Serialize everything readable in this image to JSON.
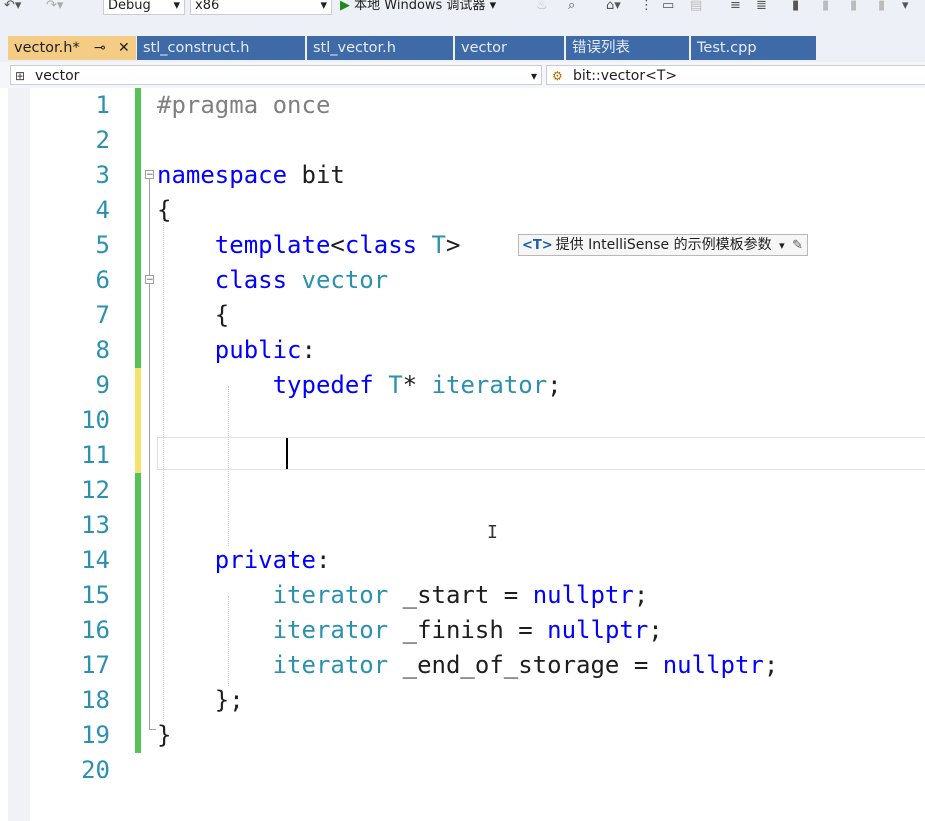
{
  "toolbar": {
    "configuration": "Debug",
    "platform": "x86",
    "run_label": "本地 Windows 调试器"
  },
  "tabs": [
    {
      "label": "vector.h*",
      "active": true,
      "pin_icon": "pin-icon",
      "close_icon": "close-icon"
    },
    {
      "label": "stl_construct.h",
      "active": false
    },
    {
      "label": "stl_vector.h",
      "active": false
    },
    {
      "label": "vector",
      "active": false
    },
    {
      "label": "错误列表",
      "active": false
    },
    {
      "label": "Test.cpp",
      "active": false
    }
  ],
  "navbar": {
    "project": "vector",
    "scope": "bit::vector<T>"
  },
  "editor": {
    "line_numbers": [
      "1",
      "2",
      "3",
      "4",
      "5",
      "6",
      "7",
      "8",
      "9",
      "10",
      "11",
      "12",
      "13",
      "14",
      "15",
      "16",
      "17",
      "18",
      "19",
      "20"
    ],
    "lines": [
      [
        {
          "t": "#pragma once",
          "c": "pp"
        }
      ],
      [],
      [
        {
          "t": "namespace",
          "c": "kw"
        },
        {
          "t": " bit",
          "c": ""
        }
      ],
      [
        {
          "t": "{",
          "c": ""
        }
      ],
      [
        {
          "t": "    ",
          "c": ""
        },
        {
          "t": "template",
          "c": "kw"
        },
        {
          "t": "<",
          "c": ""
        },
        {
          "t": "class",
          "c": "kw"
        },
        {
          "t": " ",
          "c": ""
        },
        {
          "t": "T",
          "c": "ty"
        },
        {
          "t": ">",
          "c": ""
        }
      ],
      [
        {
          "t": "    ",
          "c": ""
        },
        {
          "t": "class",
          "c": "kw"
        },
        {
          "t": " ",
          "c": ""
        },
        {
          "t": "vector",
          "c": "ty"
        }
      ],
      [
        {
          "t": "    {",
          "c": ""
        }
      ],
      [
        {
          "t": "    ",
          "c": ""
        },
        {
          "t": "public",
          "c": "kw"
        },
        {
          "t": ":",
          "c": ""
        }
      ],
      [
        {
          "t": "        ",
          "c": ""
        },
        {
          "t": "typedef",
          "c": "kw"
        },
        {
          "t": " ",
          "c": ""
        },
        {
          "t": "T",
          "c": "ty"
        },
        {
          "t": "* ",
          "c": ""
        },
        {
          "t": "iterator",
          "c": "ty"
        },
        {
          "t": ";",
          "c": ""
        }
      ],
      [],
      [],
      [],
      [],
      [
        {
          "t": "    ",
          "c": ""
        },
        {
          "t": "private",
          "c": "kw"
        },
        {
          "t": ":",
          "c": ""
        }
      ],
      [
        {
          "t": "        ",
          "c": ""
        },
        {
          "t": "iterator",
          "c": "ty"
        },
        {
          "t": " _start = ",
          "c": ""
        },
        {
          "t": "nullptr",
          "c": "kw"
        },
        {
          "t": ";",
          "c": ""
        }
      ],
      [
        {
          "t": "        ",
          "c": ""
        },
        {
          "t": "iterator",
          "c": "ty"
        },
        {
          "t": " _finish = ",
          "c": ""
        },
        {
          "t": "nullptr",
          "c": "kw"
        },
        {
          "t": ";",
          "c": ""
        }
      ],
      [
        {
          "t": "        ",
          "c": ""
        },
        {
          "t": "iterator",
          "c": "ty"
        },
        {
          "t": " _end_of_storage = ",
          "c": ""
        },
        {
          "t": "nullptr",
          "c": "kw"
        },
        {
          "t": ";",
          "c": ""
        }
      ],
      [
        {
          "t": "    };",
          "c": ""
        }
      ],
      [
        {
          "t": "}",
          "c": ""
        }
      ],
      []
    ],
    "change_markers": [
      "saved",
      "saved",
      "saved",
      "saved",
      "saved",
      "saved",
      "saved",
      "saved",
      "unsaved",
      "unsaved",
      "unsaved",
      "saved",
      "saved",
      "saved",
      "saved",
      "saved",
      "saved",
      "saved",
      "saved",
      "none"
    ],
    "colors": {
      "keyword": "#0000ff",
      "type": "#2b91af",
      "preprocessor": "#808080",
      "saved_change": "#57c357",
      "unsaved_change": "#f5e26b",
      "line_number": "#2b91af"
    }
  },
  "intellisense_tip": {
    "badge": "<T>",
    "text": "提供 IntelliSense 的示例模板参数"
  }
}
